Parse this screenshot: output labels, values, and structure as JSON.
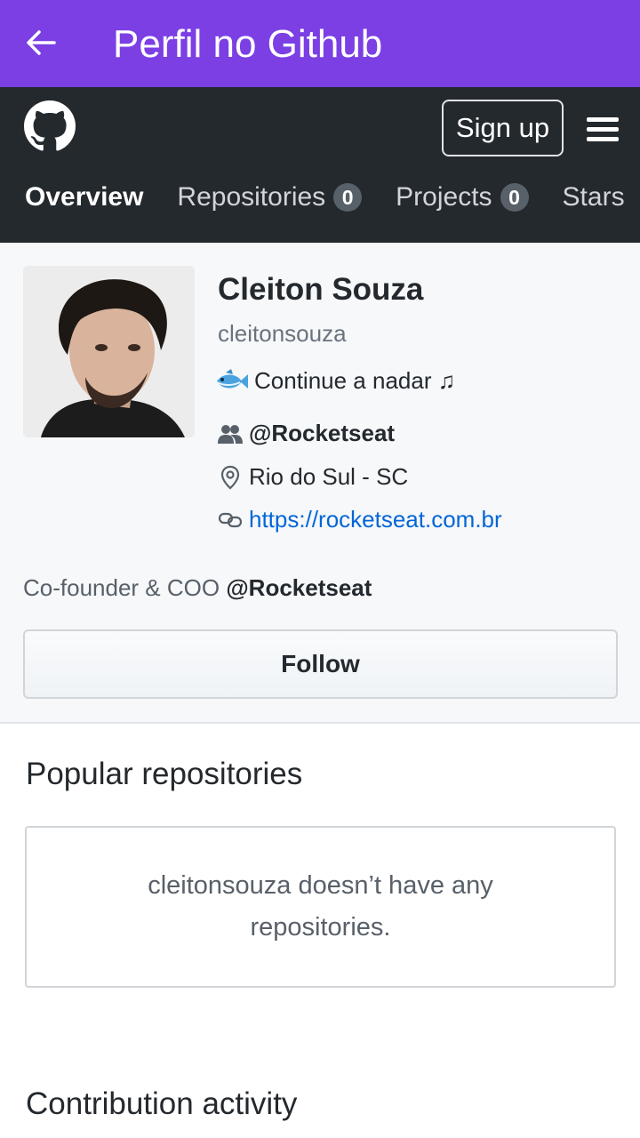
{
  "app_bar": {
    "title": "Perfil no Github",
    "back_icon": "arrow-left-icon"
  },
  "github_header": {
    "signup_label": "Sign up",
    "tabs": [
      {
        "label": "Overview",
        "active": true
      },
      {
        "label": "Repositories",
        "count": "0"
      },
      {
        "label": "Projects",
        "count": "0"
      },
      {
        "label": "Stars"
      }
    ]
  },
  "profile": {
    "name": "Cleiton Souza",
    "login": "cleitonsouza",
    "status": "Continue a nadar ♫",
    "organization": "@Rocketseat",
    "location": "Rio do Sul - SC",
    "website": "https://rocketseat.com.br",
    "bio_prefix": "Co-founder & COO",
    "bio_org": "@Rocketseat",
    "follow_label": "Follow"
  },
  "popular_repositories": {
    "title": "Popular repositories",
    "empty_message": "cleitonsouza doesn’t have any repositories."
  },
  "contribution_activity": {
    "title": "Contribution activity"
  },
  "colors": {
    "app_bar": "#7b3fe4",
    "github_header": "#24292e",
    "link": "#0366d6"
  }
}
